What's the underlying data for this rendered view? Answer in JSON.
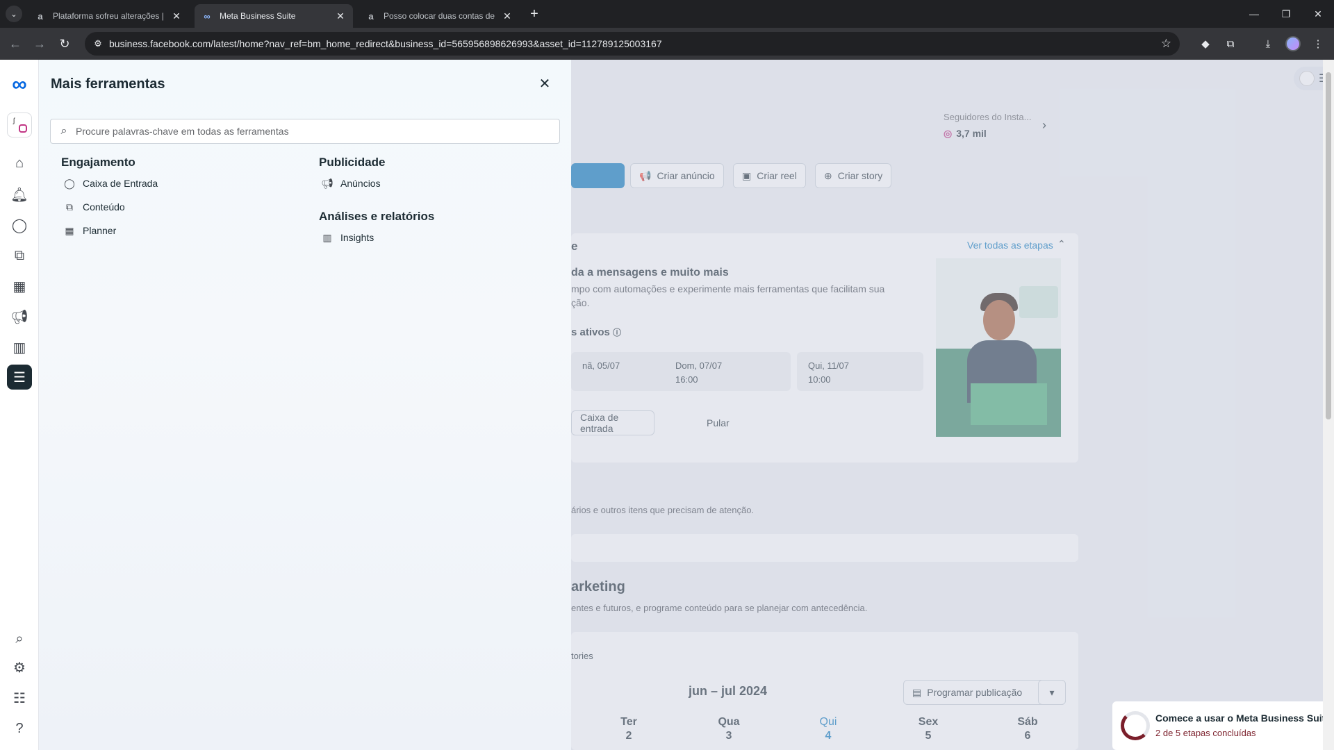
{
  "browser": {
    "tabs": [
      {
        "title": "Plataforma sofreu alterações | F",
        "favicon": "a",
        "active": false
      },
      {
        "title": "Meta Business Suite",
        "favicon": "∞",
        "active": true
      },
      {
        "title": "Posso colocar duas contas de in",
        "favicon": "a",
        "active": false
      }
    ],
    "url": "business.facebook.com/latest/home?nav_ref=bm_home_redirect&business_id=565956898626993&asset_id=112789125003167"
  },
  "rail": {
    "items": [
      "home-icon",
      "bell-icon",
      "chat-icon",
      "content-icon",
      "planner-icon",
      "megaphone-icon",
      "insights-icon",
      "menu-icon"
    ],
    "bottom": [
      "search-icon",
      "gear-icon",
      "list-icon",
      "help-icon"
    ]
  },
  "drawer": {
    "title": "Mais ferramentas",
    "search_placeholder": "Procure palavras-chave em todas as ferramentas",
    "engajamento": {
      "title": "Engajamento",
      "items": [
        "Caixa de Entrada",
        "Conteúdo",
        "Planner"
      ]
    },
    "publicidade": {
      "title": "Publicidade",
      "items": [
        "Anúncios"
      ]
    },
    "analises": {
      "title": "Análises e relatórios",
      "items": [
        "Insights"
      ]
    }
  },
  "dashboard": {
    "followers_label": "Seguidores do Insta...",
    "followers_value": "3,7 mil",
    "actions": [
      "Criar anúncio",
      "Criar reel",
      "Criar story"
    ],
    "card_heading_fragment": "e",
    "see_all_steps": "Ver todas as etapas",
    "promo_title": "da a mensagens e muito mais",
    "promo_line1": "mpo com automações e experimente mais ferramentas que facilitam sua",
    "promo_line2": "ção.",
    "active_label": "s ativos",
    "dates": [
      {
        "day": "nã, 05/07",
        "time": ""
      },
      {
        "day": "Dom, 07/07",
        "time": "16:00"
      },
      {
        "day": "Qui, 11/07",
        "time": "10:00"
      }
    ],
    "inbox_button": "Caixa de entrada",
    "skip_button": "Pular",
    "attention_text": "ários e outros itens que precisam de atenção.",
    "marketing_heading": "arketing",
    "marketing_desc": "entes e futuros, e programe conteúdo para se planejar com antecedência.",
    "stories_label": "tories",
    "calendar_range": "jun – jul 2024",
    "schedule_button": "Programar publicação",
    "weekdays": [
      {
        "name": "Ter",
        "num": "2",
        "today": false
      },
      {
        "name": "Qua",
        "num": "3",
        "today": false
      },
      {
        "name": "Qui",
        "num": "4",
        "today": true
      },
      {
        "name": "Sex",
        "num": "5",
        "today": false
      },
      {
        "name": "Sáb",
        "num": "6",
        "today": false
      }
    ],
    "setup_title": "Comece a usar o Meta Business Suite",
    "setup_progress": "2 de 5 etapas concluídas"
  },
  "colors": {
    "accent": "#0668e1",
    "primary_button": "#0a78be",
    "today": "#0a78be"
  }
}
